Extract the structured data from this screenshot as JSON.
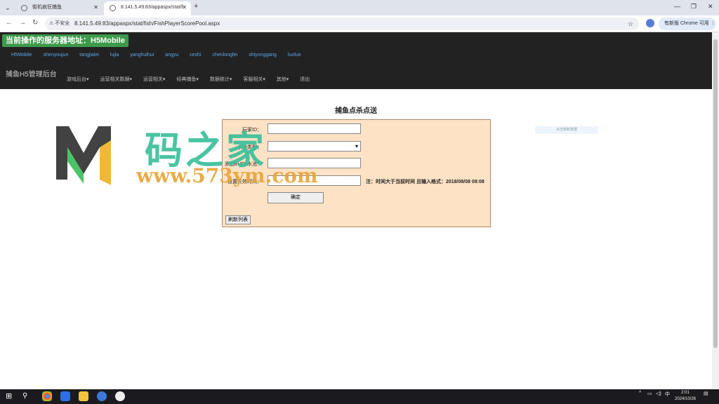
{
  "browser": {
    "tabs": [
      {
        "title": "街机疯狂捕鱼",
        "active": false
      },
      {
        "title": "8.141.5.49:83/appaspx/stat/f",
        "active": true
      }
    ],
    "address": {
      "security_label": "不安全",
      "url": "8.141.5.49:83/appaspx/stat/fish/FishPlayerScorePool.aspx"
    },
    "update_label": "有新版 Chrome 可用"
  },
  "header": {
    "server_banner": "当前操作的服务器地址：H5Mobile",
    "servers": [
      "H5Mobile",
      "shenyoujun",
      "tangjialei",
      "lujia",
      "yanghuihui",
      "angyu",
      "ceshi",
      "chenlongfei",
      "shiyonggang",
      "luoluo"
    ],
    "brand": "捕鱼H5管理后台",
    "menu": [
      "游戏后台▾",
      "运营相关数据▾",
      "运营相关▾",
      "经典捕鱼▾",
      "数据统计▾",
      "客服相关▾",
      "其他▾",
      "退出"
    ]
  },
  "main": {
    "title": "捕鱼点杀点送",
    "form": {
      "player_id_label": "玩家ID：",
      "player_id_value": "",
      "pool_type_label": "水池类型：",
      "pool_type_value": "",
      "buff_label": "添加BUFF水池：",
      "buff_value": "",
      "expire_label": "设置失效时间：",
      "expire_value": "",
      "expire_note": "注：时间大于当前时间 且输入格式：2018/08/08 08:08",
      "confirm_label": "确定",
      "refresh_label": "刷新列表"
    },
    "right_hint": "点击刷新数据"
  },
  "watermark": {
    "text": "码之家",
    "url": "www.573ym.com"
  },
  "taskbar": {
    "ime": "中",
    "time": "2:01",
    "date": "2024/10/26"
  },
  "colors": {
    "header_bg": "#222222",
    "banner_green": "#3d9a4a",
    "server_link": "#5aa6e6",
    "form_bg": "#fde2c5"
  }
}
